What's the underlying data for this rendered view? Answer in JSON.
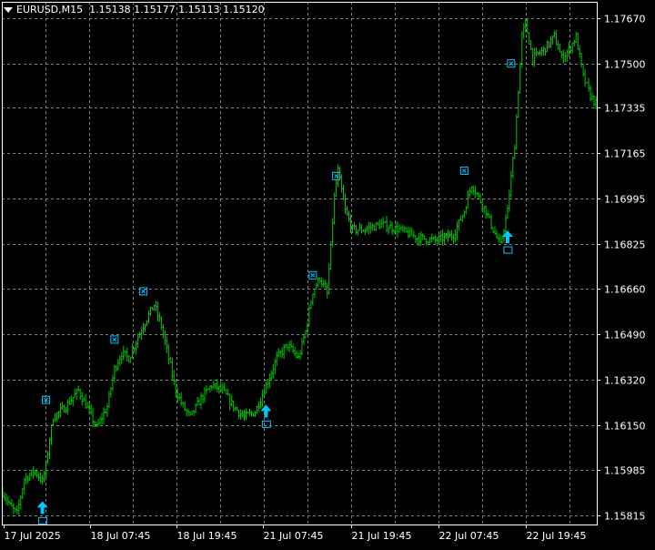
{
  "header": {
    "symbol": "EURUSD,M15",
    "ohlc": "1.15138 1.15177 1.15113 1.15120"
  },
  "colors": {
    "background": "#000000",
    "grid": "#7f7f7f",
    "axis": "#ffffff",
    "candles": "#00c800",
    "arrows": "#00c8ff",
    "text": "#ffffff"
  },
  "chart_data": {
    "type": "ohlc",
    "grid": true,
    "ylim": [
      1.1578,
      1.1773
    ],
    "y_ticks": [
      "1.17670",
      "1.17500",
      "1.17335",
      "1.17165",
      "1.16995",
      "1.16825",
      "1.16660",
      "1.16490",
      "1.16320",
      "1.16150",
      "1.15985",
      "1.15815"
    ],
    "x_ticks": [
      "17 Jul 2025",
      "18 Jul 07:45",
      "18 Jul 19:45",
      "21 Jul 07:45",
      "21 Jul 19:45",
      "22 Jul 07:45",
      "22 Jul 19:45"
    ],
    "bar_count": 330,
    "price_path": [
      [
        0,
        1.159
      ],
      [
        4,
        1.1585
      ],
      [
        8,
        1.1582
      ],
      [
        12,
        1.1595
      ],
      [
        18,
        1.1598
      ],
      [
        22,
        1.1594
      ],
      [
        24,
        1.16
      ],
      [
        26,
        1.161
      ],
      [
        28,
        1.1618
      ],
      [
        35,
        1.1622
      ],
      [
        42,
        1.1628
      ],
      [
        48,
        1.162
      ],
      [
        52,
        1.1614
      ],
      [
        58,
        1.1622
      ],
      [
        62,
        1.1636
      ],
      [
        66,
        1.1642
      ],
      [
        70,
        1.164
      ],
      [
        75,
        1.1648
      ],
      [
        80,
        1.1655
      ],
      [
        84,
        1.166
      ],
      [
        88,
        1.1652
      ],
      [
        92,
        1.164
      ],
      [
        96,
        1.1628
      ],
      [
        100,
        1.1622
      ],
      [
        104,
        1.1618
      ],
      [
        110,
        1.1625
      ],
      [
        116,
        1.163
      ],
      [
        122,
        1.1628
      ],
      [
        128,
        1.1622
      ],
      [
        134,
        1.1618
      ],
      [
        140,
        1.162
      ],
      [
        146,
        1.163
      ],
      [
        152,
        1.164
      ],
      [
        158,
        1.1645
      ],
      [
        164,
        1.164
      ],
      [
        168,
        1.165
      ],
      [
        172,
        1.1665
      ],
      [
        176,
        1.167
      ],
      [
        180,
        1.1664
      ],
      [
        184,
        1.17
      ],
      [
        186,
        1.171
      ],
      [
        190,
        1.1695
      ],
      [
        194,
        1.1688
      ],
      [
        200,
        1.1688
      ],
      [
        210,
        1.169
      ],
      [
        220,
        1.1688
      ],
      [
        230,
        1.1685
      ],
      [
        240,
        1.1684
      ],
      [
        250,
        1.1686
      ],
      [
        256,
        1.1695
      ],
      [
        260,
        1.1705
      ],
      [
        264,
        1.17
      ],
      [
        268,
        1.1695
      ],
      [
        272,
        1.1688
      ],
      [
        276,
        1.1682
      ],
      [
        280,
        1.1695
      ],
      [
        284,
        1.172
      ],
      [
        286,
        1.174
      ],
      [
        288,
        1.176
      ],
      [
        290,
        1.1765
      ],
      [
        294,
        1.1752
      ],
      [
        300,
        1.1755
      ],
      [
        306,
        1.176
      ],
      [
        310,
        1.1752
      ],
      [
        314,
        1.1755
      ],
      [
        318,
        1.176
      ],
      [
        322,
        1.1745
      ],
      [
        326,
        1.1738
      ],
      [
        329,
        1.1735
      ]
    ],
    "arrows": [
      22,
      146,
      280
    ],
    "markers": [
      {
        "bar": 24,
        "price": 1.16245
      },
      {
        "bar": 62,
        "price": 1.1647
      },
      {
        "bar": 78,
        "price": 1.1665
      },
      {
        "bar": 172,
        "price": 1.1671
      },
      {
        "bar": 185,
        "price": 1.1708
      },
      {
        "bar": 256,
        "price": 1.171
      },
      {
        "bar": 282,
        "price": 1.175
      }
    ]
  }
}
